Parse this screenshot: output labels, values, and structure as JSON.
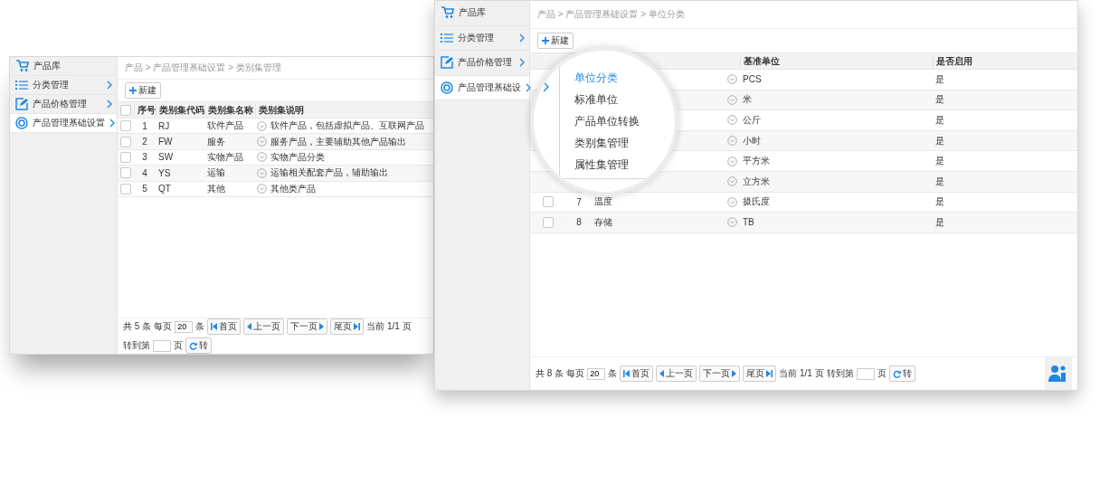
{
  "back_window": {
    "sidebar": [
      {
        "label": "产品库",
        "kind": "cart",
        "expandable": false,
        "selected": false
      },
      {
        "label": "分类管理",
        "kind": "list",
        "expandable": true,
        "selected": false
      },
      {
        "label": "产品价格管理",
        "kind": "edit",
        "expandable": true,
        "selected": false
      },
      {
        "label": "产品管理基础设置",
        "kind": "settings",
        "expandable": true,
        "selected": true
      }
    ],
    "breadcrumb": "产品 > 产品管理基础设置 > 类别集管理",
    "new_button": "新建",
    "table": {
      "select_all": {
        "checked": false
      },
      "columns": [
        {
          "label": "序号"
        },
        {
          "label": "类别集代码"
        },
        {
          "label": "类别集名称"
        },
        {
          "label": "类别集说明"
        }
      ],
      "rows": [
        {
          "checked": false,
          "number": "1",
          "code": "RJ",
          "name": "软件产品",
          "description": "软件产品，包括虚拟产品、互联网产品"
        },
        {
          "checked": false,
          "number": "2",
          "code": "FW",
          "name": "服务",
          "description": "服务产品，主要辅助其他产品输出"
        },
        {
          "checked": false,
          "number": "3",
          "code": "SW",
          "name": "实物产品",
          "description": "实物产品分类"
        },
        {
          "checked": false,
          "number": "4",
          "code": "YS",
          "name": "运输",
          "description": "运输相关配套产品，辅助输出"
        },
        {
          "checked": false,
          "number": "5",
          "code": "QT",
          "name": "其他",
          "description": "其他类产品"
        }
      ]
    },
    "pager": [
      {
        "kind": "text",
        "text": "共 5 条"
      },
      {
        "kind": "text",
        "text": "每页"
      },
      {
        "kind": "input",
        "value": "20"
      },
      {
        "kind": "text",
        "text": "条"
      },
      {
        "kind": "first",
        "label": "首页"
      },
      {
        "kind": "prev",
        "label": "上一页"
      },
      {
        "kind": "next",
        "label": "下一页"
      },
      {
        "kind": "last",
        "label": "尾页"
      },
      {
        "kind": "text",
        "text": "当前 1/1 页"
      },
      {
        "kind": "text",
        "text": "转到第"
      },
      {
        "kind": "input"
      },
      {
        "kind": "text",
        "text": "页"
      },
      {
        "kind": "go",
        "label": "转"
      }
    ]
  },
  "front_window": {
    "sidebar": [
      {
        "label": "产品库",
        "kind": "cart",
        "expandable": false,
        "selected": false
      },
      {
        "label": "分类管理",
        "kind": "list",
        "expandable": true,
        "selected": false
      },
      {
        "label": "产品价格管理",
        "kind": "edit",
        "expandable": true,
        "selected": false
      },
      {
        "label": "产品管理基础设",
        "kind": "settings",
        "expandable": true,
        "selected": true
      }
    ],
    "breadcrumb": "产品 > 产品管理基础设置 > 单位分类",
    "new_button": "新建",
    "table": {
      "columns": [
        {
          "label": "基准单位"
        },
        {
          "label": "是否启用"
        }
      ],
      "rows": [
        {
          "unit": "PCS",
          "enabled": "是"
        },
        {
          "unit": "米",
          "enabled": "是"
        },
        {
          "unit": "公斤",
          "enabled": "是"
        },
        {
          "unit": "小时",
          "enabled": "是"
        },
        {
          "unit": "平方米",
          "enabled": "是"
        },
        {
          "unit": "立方米",
          "enabled": "是"
        },
        {
          "checked": false,
          "number": "7",
          "name": "温度",
          "unit": "摄氏度",
          "enabled": "是"
        },
        {
          "checked": false,
          "number": "8",
          "name": "存储",
          "unit": "TB",
          "enabled": "是"
        }
      ]
    },
    "pager": [
      {
        "kind": "text",
        "text": "共 8 条"
      },
      {
        "kind": "text",
        "text": "每页"
      },
      {
        "kind": "input",
        "value": "20"
      },
      {
        "kind": "text",
        "text": "条"
      },
      {
        "kind": "first",
        "label": "首页"
      },
      {
        "kind": "prev",
        "label": "上一页"
      },
      {
        "kind": "next",
        "label": "下一页"
      },
      {
        "kind": "last",
        "label": "尾页"
      },
      {
        "kind": "text",
        "text": "当前 1/1 页"
      },
      {
        "kind": "text",
        "text": "转到第"
      },
      {
        "kind": "input"
      },
      {
        "kind": "text",
        "text": "页"
      },
      {
        "kind": "go",
        "label": "转"
      }
    ]
  },
  "magnifier_menu": {
    "items": [
      {
        "label": "单位分类",
        "selected": true
      },
      {
        "label": "标准单位",
        "selected": false
      },
      {
        "label": "产品单位转换",
        "selected": false
      },
      {
        "label": "类别集管理",
        "selected": false
      },
      {
        "label": "属性集管理",
        "selected": false
      }
    ]
  }
}
